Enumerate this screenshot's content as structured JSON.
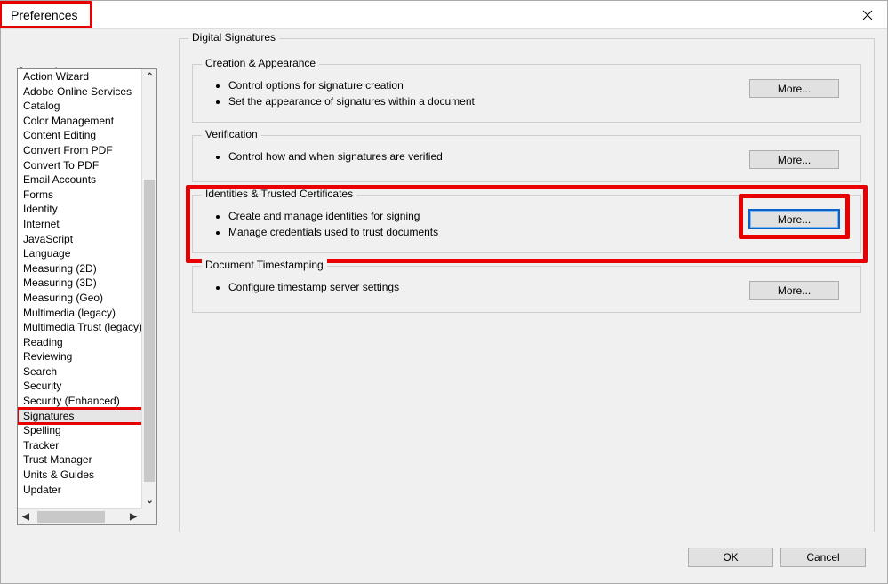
{
  "window": {
    "title": "Preferences"
  },
  "categories_label": "Categories:",
  "categories": [
    "Action Wizard",
    "Adobe Online Services",
    "Catalog",
    "Color Management",
    "Content Editing",
    "Convert From PDF",
    "Convert To PDF",
    "Email Accounts",
    "Forms",
    "Identity",
    "Internet",
    "JavaScript",
    "Language",
    "Measuring (2D)",
    "Measuring (3D)",
    "Measuring (Geo)",
    "Multimedia (legacy)",
    "Multimedia Trust (legacy)",
    "Reading",
    "Reviewing",
    "Search",
    "Security",
    "Security (Enhanced)",
    "Signatures",
    "Spelling",
    "Tracker",
    "Trust Manager",
    "Units & Guides",
    "Updater"
  ],
  "selected_category_index": 23,
  "panel": {
    "title": "Digital Signatures",
    "groups": [
      {
        "title": "Creation & Appearance",
        "bullets": [
          "Control options for signature creation",
          "Set the appearance of signatures within a document"
        ],
        "button": "More..."
      },
      {
        "title": "Verification",
        "bullets": [
          "Control how and when signatures are verified"
        ],
        "button": "More..."
      },
      {
        "title": "Identities & Trusted Certificates",
        "bullets": [
          "Create and manage identities for signing",
          "Manage credentials used to trust documents"
        ],
        "button": "More..."
      },
      {
        "title": "Document Timestamping",
        "bullets": [
          "Configure timestamp server settings"
        ],
        "button": "More..."
      }
    ]
  },
  "footer": {
    "ok": "OK",
    "cancel": "Cancel"
  }
}
